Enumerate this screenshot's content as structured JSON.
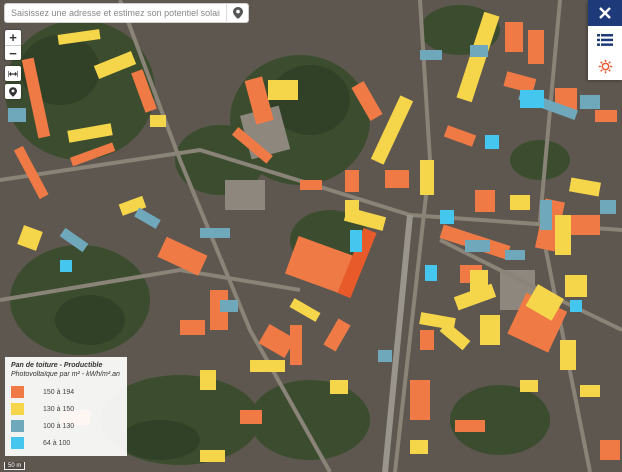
{
  "search": {
    "placeholder": "Saisissez une adresse et estimez son potentiel solaire en toiture",
    "value": ""
  },
  "controls": {
    "zoom_in": "+",
    "zoom_out": "−"
  },
  "icons": {
    "search": "map-pin-icon",
    "measure": "measure-icon",
    "locate": "location-pin-icon",
    "close": "close-icon",
    "layers": "list-icon",
    "settings": "gear-icon"
  },
  "legend": {
    "title": "Pan de toiture - Productible",
    "unit": "Photovoltaïque par m² - kWh/m².an",
    "classes": [
      {
        "label": "150 à 194",
        "color": "#ef7a45"
      },
      {
        "label": "130 à 150",
        "color": "#f5d54a"
      },
      {
        "label": "100 à 130",
        "color": "#6fa8bb"
      },
      {
        "label": "64 à 100",
        "color": "#44c6ee"
      }
    ]
  },
  "scale": {
    "label": "50 m"
  },
  "colors": {
    "accent": "#1e3a78",
    "roof_high": "#ef7a45",
    "roof_mid": "#f5d54a",
    "roof_low": "#6fa8bb",
    "roof_min": "#44c6ee",
    "vegetation": "#3d5230",
    "urban": "#6b5f55"
  }
}
